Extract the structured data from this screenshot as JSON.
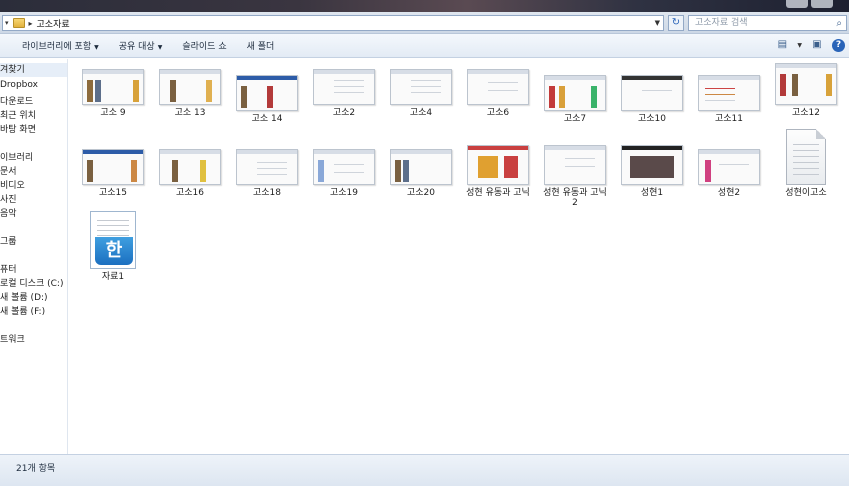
{
  "address": {
    "crumb": "고소자료",
    "search_placeholder": "고소자료 검색"
  },
  "toolbar": {
    "items": [
      "라이브러리에 포함",
      "공유 대상",
      "슬라이드 쇼",
      "새 폴더"
    ]
  },
  "nav": {
    "items": [
      "겨찾기",
      "Dropbox",
      "다운로드",
      "최근 위치",
      "바탕 화면",
      "이브러리",
      "문서",
      "비디오",
      "사진",
      "음악",
      "그룹",
      "퓨터",
      "로컬 디스크 (C:)",
      "새 볼륨 (D:)",
      "새 볼륨 (F:)",
      "트워크"
    ]
  },
  "files": [
    {
      "name": "고소 9"
    },
    {
      "name": "고소 13"
    },
    {
      "name": "고소 14"
    },
    {
      "name": "고소2"
    },
    {
      "name": "고소4"
    },
    {
      "name": "고소6"
    },
    {
      "name": "고소7"
    },
    {
      "name": "고소10"
    },
    {
      "name": "고소11"
    },
    {
      "name": "고소12"
    },
    {
      "name": "고소15"
    },
    {
      "name": "고소16"
    },
    {
      "name": "고소18"
    },
    {
      "name": "고소19"
    },
    {
      "name": "고소20"
    },
    {
      "name": "성현 유동과 고닉"
    },
    {
      "name": "성현 유동과 고닉 2"
    },
    {
      "name": "성현1"
    },
    {
      "name": "성현2"
    },
    {
      "name": "성현이고소"
    },
    {
      "name": "자료1"
    }
  ],
  "hwp_badge": "한",
  "status": {
    "count": "21개 항목"
  }
}
